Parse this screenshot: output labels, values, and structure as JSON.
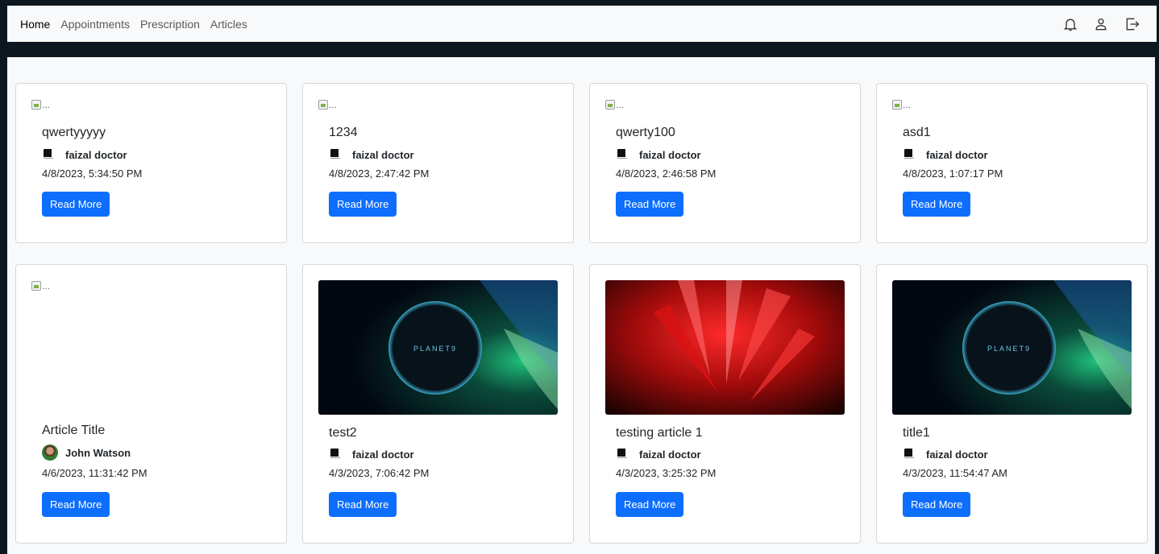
{
  "nav": {
    "links": [
      "Home",
      "Appointments",
      "Prescription",
      "Articles"
    ],
    "icons": [
      "bell-icon",
      "user-icon",
      "logout-icon"
    ]
  },
  "broken_image_alt": "...",
  "read_more_label": "Read More",
  "articles": [
    {
      "title": "qwertyyyyy",
      "author": "faizal doctor",
      "date": "4/8/2023, 5:34:50 PM"
    },
    {
      "title": "1234",
      "author": "faizal doctor",
      "date": "4/8/2023, 2:47:42 PM"
    },
    {
      "title": "qwerty100",
      "author": "faizal doctor",
      "date": "4/8/2023, 2:46:58 PM"
    },
    {
      "title": "asd1",
      "author": "faizal doctor",
      "date": "4/8/2023, 1:07:17 PM"
    },
    {
      "title": "Article Title",
      "author": "John Watson",
      "date": "4/6/2023, 11:31:42 PM"
    },
    {
      "title": "test2",
      "author": "faizal doctor",
      "date": "4/3/2023, 7:06:42 PM",
      "image_text": "PLANET9"
    },
    {
      "title": "testing article 1",
      "author": "faizal doctor",
      "date": "4/3/2023, 3:25:32 PM"
    },
    {
      "title": "title1",
      "author": "faizal doctor",
      "date": "4/3/2023, 11:54:47 AM",
      "image_text": "PLANET9"
    }
  ],
  "colors": {
    "primary": "#0d6efd",
    "page_bg": "#0d1720",
    "content_bg": "#f8f9fa"
  }
}
